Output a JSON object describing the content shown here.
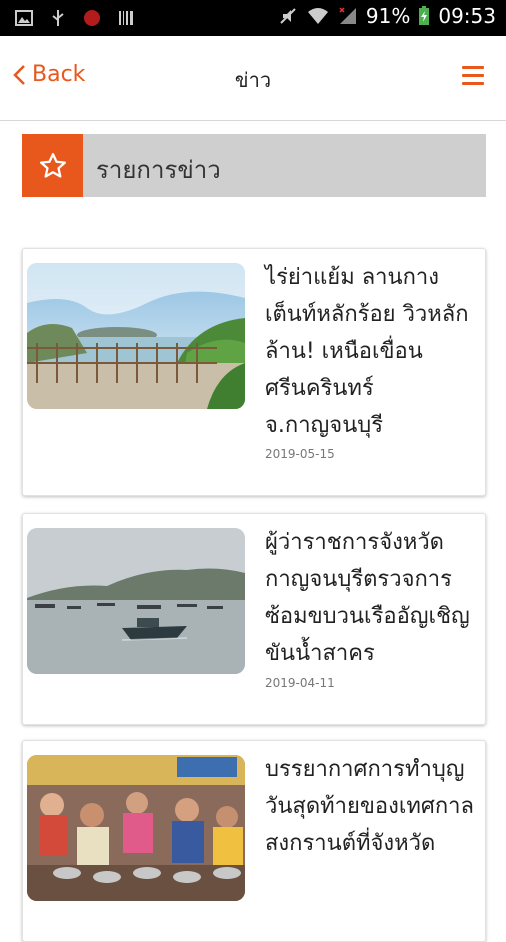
{
  "status": {
    "battery": "91%",
    "time": "09:53"
  },
  "nav": {
    "back_label": "Back",
    "title": "ข่าว"
  },
  "section": {
    "label": "รายการข่าว"
  },
  "news": [
    {
      "title": "ไร่ย่าแย้ม ลานกางเต็นท์หลักร้อย วิวหลักล้าน! เหนือเขื่อนศรีนครินทร์ จ.กาญจนบุรี",
      "date": "2019-05-15"
    },
    {
      "title": "ผู้ว่าราชการจังหวัดกาญจนบุรีตรวจการซ้อมขบวนเรืออัญเชิญขันน้ำสาคร",
      "date": "2019-04-11"
    },
    {
      "title": "บรรยากาศการทำบุญวันสุดท้ายของเทศกาลสงกรานต์ที่จังหวัด",
      "date": ""
    }
  ]
}
